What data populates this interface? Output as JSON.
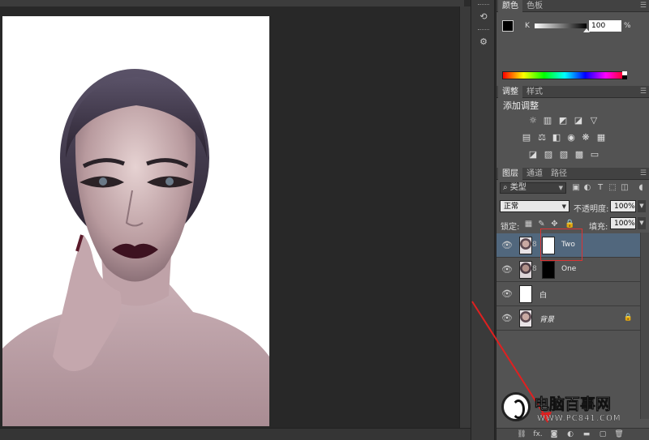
{
  "color_panel": {
    "tabs": [
      "颜色",
      "色板"
    ],
    "channel_label": "K",
    "channel_value": "100",
    "channel_unit": "%",
    "channel_level": 1.0,
    "foreground": "#000000",
    "background": "#ffffff"
  },
  "adjustments_panel": {
    "tabs": [
      "调整",
      "样式"
    ],
    "title": "添加调整",
    "icons_row1": [
      "brightness-icon",
      "levels-icon",
      "curves-icon",
      "exposure-icon",
      "vibrance-icon"
    ],
    "icons_row2": [
      "hue-saturation-icon",
      "color-balance-icon",
      "black-white-icon",
      "photo-filter-icon",
      "channel-mixer-icon",
      "color-lookup-icon"
    ],
    "icons_row3": [
      "invert-icon",
      "posterize-icon",
      "threshold-icon",
      "selective-color-icon",
      "gradient-map-icon"
    ]
  },
  "layers_panel": {
    "tabs": [
      "图层",
      "通道",
      "路径"
    ],
    "filter_kind": "类型",
    "blend_mode": "正常",
    "opacity_label": "不透明度:",
    "opacity_value": "100%",
    "lock_label": "锁定:",
    "fill_label": "填充:",
    "fill_value": "100%",
    "layers": [
      {
        "name": "Two",
        "selected": true,
        "thumb": "face",
        "mask": "white",
        "has_mask": true
      },
      {
        "name": "One",
        "selected": false,
        "thumb": "face-dark",
        "mask": "black",
        "has_mask": true
      },
      {
        "name": "白",
        "selected": false,
        "thumb": "white",
        "has_mask": false
      },
      {
        "name": "背景",
        "selected": false,
        "thumb": "face",
        "has_mask": false,
        "locked": true,
        "italic": true
      }
    ],
    "footer_icons": [
      "link-icon",
      "fx-icon",
      "mask-icon",
      "adjustment-layer-icon",
      "group-icon",
      "new-layer-icon",
      "trash-icon"
    ],
    "footer_fx_label": "fx."
  },
  "watermark": {
    "title": "电脑百事网",
    "url": "WWW.PC841.COM"
  },
  "colors": {
    "selected_layer": "#51677d",
    "highlight_box": "#dd3333",
    "panel_bg": "#535353",
    "workspace_bg": "#282828"
  }
}
